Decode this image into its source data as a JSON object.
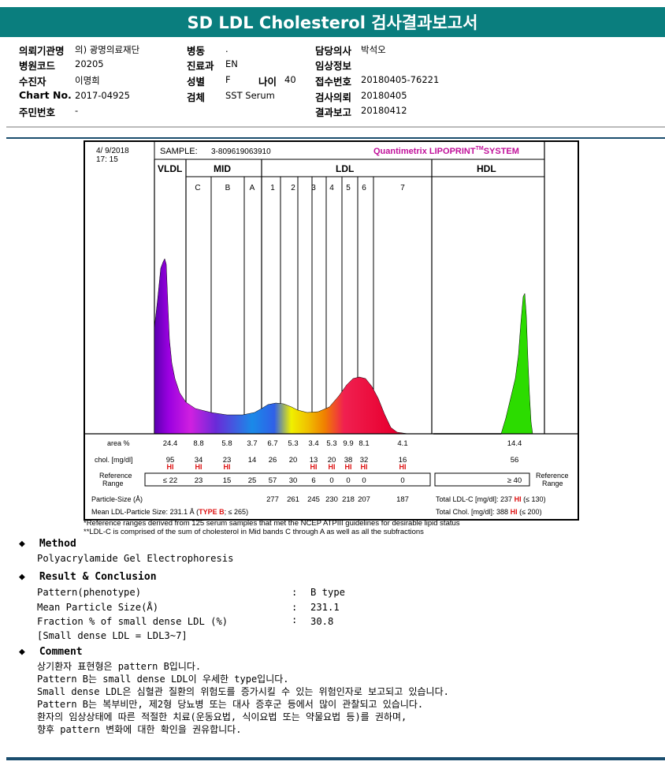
{
  "title": "SD LDL Cholesterol 검사결과보고서",
  "info": {
    "col1": [
      {
        "label": "의뢰기관명",
        "value": "의) 광명의료재단"
      },
      {
        "label": "병원코드",
        "value": "20205"
      },
      {
        "label": "수진자",
        "value": "이명희"
      },
      {
        "label": "Chart No.",
        "value": "2017-04925"
      },
      {
        "label": "주민번호",
        "value": "-"
      }
    ],
    "col2": [
      {
        "label": "병동",
        "value": "."
      },
      {
        "label": "진료과",
        "value": "EN"
      },
      {
        "label": "성별",
        "value": "F"
      },
      {
        "label": "검체",
        "value": "SST Serum"
      }
    ],
    "age": {
      "label": "나이",
      "value": "40"
    },
    "col3": [
      {
        "label": "담당의사",
        "value": "박석오"
      },
      {
        "label": "임상정보",
        "value": ""
      },
      {
        "label": "접수번호",
        "value": "20180405-76221"
      },
      {
        "label": "검사의뢰",
        "value": "20180405"
      },
      {
        "label": "결과보고",
        "value": "20180412"
      }
    ]
  },
  "report": {
    "date": "4/ 9/2018",
    "time": "17: 15",
    "sample_label": "SAMPLE:",
    "sample_id": "3-809619063910",
    "brand": "Quantimetrix LIPOPRINT",
    "brand_sup": "TM",
    "brand_tail": "SYSTEM",
    "groups": {
      "vldl": "VLDL",
      "mid": "MID",
      "ldl": "LDL",
      "hdl": "HDL"
    },
    "bands": [
      "C",
      "B",
      "A",
      "1",
      "2",
      "3",
      "4",
      "5",
      "6",
      "7"
    ],
    "row_labels": {
      "area": "area %",
      "chol": "chol. [mg/dl]",
      "ref": "Reference Range",
      "ref_right": "Reference Range",
      "size": "Particle-Size (Å)",
      "mean": "Mean LDL-Particle Size:"
    },
    "area": [
      "24.4",
      "8.8",
      "5.8",
      "3.7",
      "6.7",
      "5.3",
      "3.4",
      "5.3",
      "9.9",
      "8.1",
      "4.1",
      "14.4"
    ],
    "chol": [
      "95",
      "34",
      "23",
      "14",
      "26",
      "20",
      "13",
      "20",
      "38",
      "32",
      "16",
      "56"
    ],
    "hi_flags": [
      "HI",
      "HI",
      "HI",
      "",
      "",
      "",
      "HI",
      "HI",
      "HI",
      "HI",
      "HI",
      ""
    ],
    "ref": [
      "≤ 22",
      "23",
      "15",
      "25",
      "57",
      "30",
      "6",
      "0",
      "0",
      "0",
      "0",
      "≥ 40"
    ],
    "size": [
      "277",
      "261",
      "245",
      "230",
      "218",
      "207",
      "187"
    ],
    "mean_value": "231.1 Å (",
    "mean_type": "TYPE B",
    "mean_tail": "; ≤ 265)",
    "total_ldl_label": "Total LDL-C [mg/dl]:",
    "total_ldl_value": "237",
    "total_ldl_flag": "HI",
    "total_ldl_ref": "(≤ 130)",
    "total_chol_label": "Total Chol. [mg/dl]:",
    "total_chol_value": "388",
    "total_chol_flag": "HI",
    "total_chol_ref": "(≤ 200)"
  },
  "footnotes": [
    "*Reference ranges derived from 125 serum samples that met the NCEP ATPIII guidelines for desirable lipid status",
    "**LDL-C is comprised of the sum of cholesterol in Mid bands C through A as well as all the subfractions"
  ],
  "method": {
    "heading": "Method",
    "text": "Polyacrylamide Gel Electrophoresis"
  },
  "result": {
    "heading": "Result & Conclusion",
    "rows": [
      {
        "label": "Pattern(phenotype)",
        "value": "B type"
      },
      {
        "label": "Mean Particle Size(Å)",
        "value": "231.1"
      },
      {
        "label": "Fraction % of small dense LDL (%)",
        "value": "30.8"
      }
    ],
    "note": "[Small dense LDL = LDL3~7]"
  },
  "comment": {
    "heading": "Comment",
    "lines": [
      "상기환자 표현형은 pattern B입니다.",
      "Pattern B는 small dense LDL이 우세한 type입니다.",
      "Small dense LDL은 심혈관 질환의 위험도를 증가시킬 수 있는 위험인자로 보고되고 있습니다.",
      "Pattern B는 복부비만, 제2형 당뇨병 또는 대사 증후군 등에서 많이 관찰되고 있습니다.",
      "환자의 임상상태에 따른 적절한 치료(운동요법, 식이요법 또는 약물요법 등)를 권하며,",
      "향후 pattern 변화에 대한 확인을 권유합니다."
    ]
  },
  "colors": {
    "header": "#0a7e7e",
    "rule": "#1a4d6e",
    "hi": "#d11",
    "brand": "#c0109a"
  }
}
